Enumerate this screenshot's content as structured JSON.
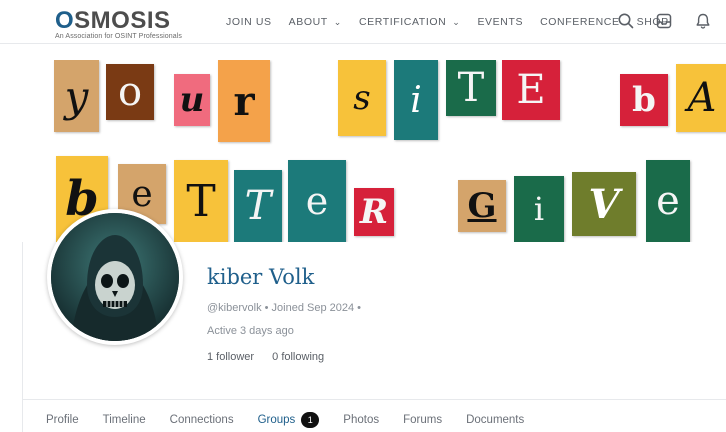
{
  "brand": {
    "logo_first": "O",
    "logo_rest": "SMOSIS",
    "tagline": "An Association for OSINT Professionals"
  },
  "nav": {
    "items": [
      {
        "label": "JOIN US"
      },
      {
        "label": "ABOUT",
        "has_dropdown": true
      },
      {
        "label": "CERTIFICATION",
        "has_dropdown": true
      },
      {
        "label": "EVENTS"
      },
      {
        "label": "CONFERENCE"
      },
      {
        "label": "SHOP"
      }
    ]
  },
  "header_icons": [
    "search-icon",
    "inbox-icon",
    "bell-icon"
  ],
  "cover": {
    "letters": [
      "y",
      "o",
      "u",
      "r",
      "s",
      "i",
      "T",
      "E",
      "b",
      "A",
      "b",
      "e",
      "T",
      "T",
      "e",
      "R",
      "G",
      "i",
      "V",
      "e"
    ],
    "colors": {
      "orange": "#f4a24a",
      "brown": "#7a3a14",
      "pink": "#f06b7e",
      "teal": "#1c7a7a",
      "green": "#1a6b4a",
      "red": "#d6213a",
      "yellow": "#f7c23a",
      "tan": "#d4a46b",
      "olive": "#6f7d2c"
    }
  },
  "profile": {
    "display_name": "kiber Volk",
    "meta": "@kibervolk • Joined Sep 2024 •",
    "active": "Active 3 days ago",
    "followers": "1 follower",
    "following": "0 following"
  },
  "tabs": [
    {
      "label": "Profile"
    },
    {
      "label": "Timeline"
    },
    {
      "label": "Connections"
    },
    {
      "label": "Groups",
      "badge": "1",
      "active": true
    },
    {
      "label": "Photos"
    },
    {
      "label": "Forums"
    },
    {
      "label": "Documents"
    }
  ],
  "accent_color": "#1f5f8b"
}
